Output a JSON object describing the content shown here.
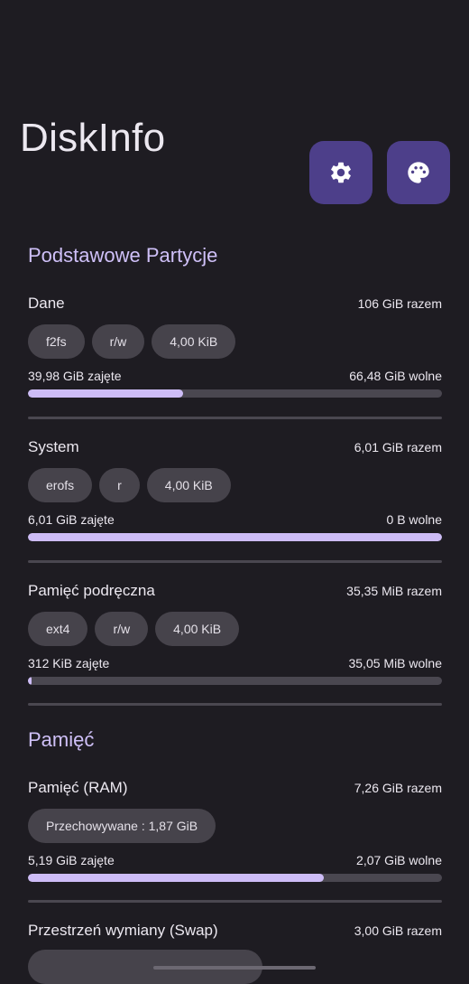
{
  "app_title": "DiskInfo",
  "icons": {
    "settings": "gear-icon",
    "theme": "palette-icon"
  },
  "colors": {
    "background": "#1e1c22",
    "accent": "#cdbcf6",
    "button": "#4d3f8a",
    "chip": "#46434b"
  },
  "sections": {
    "partitions_title": "Podstawowe Partycje",
    "memory_title": "Pamięć"
  },
  "partitions": [
    {
      "name": "Dane",
      "total": "106 GiB razem",
      "chips": [
        "f2fs",
        "r/w",
        "4,00 KiB"
      ],
      "used": "39,98 GiB zajęte",
      "free": "66,48 GiB wolne",
      "fraction": 0.375
    },
    {
      "name": "System",
      "total": "6,01 GiB razem",
      "chips": [
        "erofs",
        "r",
        "4,00 KiB"
      ],
      "used": "6,01 GiB zajęte",
      "free": "0 B wolne",
      "fraction": 1.0
    },
    {
      "name": "Pamięć podręczna",
      "total": "35,35 MiB razem",
      "chips": [
        "ext4",
        "r/w",
        "4,00 KiB"
      ],
      "used": "312 KiB zajęte",
      "free": "35,05 MiB wolne",
      "fraction": 0.009
    }
  ],
  "memory": [
    {
      "name": "Pamięć (RAM)",
      "total": "7,26 GiB razem",
      "chips": [
        "Przechowywane : 1,87 GiB"
      ],
      "used": "5,19 GiB zajęte",
      "free": "2,07 GiB wolne",
      "fraction": 0.715
    },
    {
      "name": "Przestrzeń wymiany (Swap)",
      "total": "3,00 GiB razem"
    }
  ]
}
